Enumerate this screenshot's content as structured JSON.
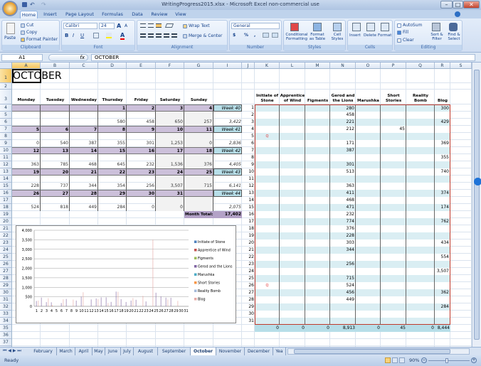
{
  "window": {
    "title": "WritingProgress2015.xlsx - Microsoft Excel non-commercial use"
  },
  "ribbon": {
    "tabs": [
      "Home",
      "Insert",
      "Page Layout",
      "Formulas",
      "Data",
      "Review",
      "View"
    ],
    "active_tab": "Home",
    "clipboard": {
      "label": "Clipboard",
      "paste": "Paste",
      "cut": "Cut",
      "copy": "Copy",
      "format_painter": "Format Painter"
    },
    "font": {
      "label": "Font",
      "name": "Calibri",
      "size": "24",
      "bold": "B",
      "italic": "I",
      "underline": "U",
      "grow": "A",
      "shrink": "A",
      "color": "A"
    },
    "alignment": {
      "label": "Alignment",
      "wrap": "Wrap Text",
      "merge": "Merge & Center"
    },
    "number": {
      "label": "Number",
      "format": "General",
      "currency": "$",
      "percent": "%",
      "comma": ","
    },
    "styles": {
      "label": "Styles",
      "conditional": "Conditional Formatting",
      "format_table": "Format as Table",
      "cell_styles": "Cell Styles"
    },
    "cells": {
      "label": "Cells",
      "insert": "Insert",
      "delete": "Delete",
      "format": "Format"
    },
    "editing": {
      "label": "Editing",
      "autosum": "AutoSum",
      "fill": "Fill",
      "clear": "Clear",
      "sort": "Sort & Filter",
      "find": "Find & Select"
    }
  },
  "formula_bar": {
    "name_box": "A1",
    "fx": "fx",
    "value": "OCTOBER"
  },
  "columns": [
    "A",
    "B",
    "C",
    "D",
    "E",
    "F",
    "G",
    "I",
    "J",
    "K",
    "L",
    "M",
    "N",
    "O",
    "P",
    "Q",
    "R",
    "S"
  ],
  "rows": [
    "1",
    "2",
    "3",
    "4",
    "5",
    "6",
    "7",
    "8",
    "9",
    "10",
    "11",
    "12",
    "13",
    "14",
    "15",
    "16",
    "17",
    "18",
    "19",
    "20",
    "21",
    "22",
    "23",
    "24",
    "25",
    "26",
    "27",
    "28",
    "29",
    "30",
    "31",
    "32",
    "33",
    "34",
    "35",
    "36",
    "37",
    "38"
  ],
  "calendar": {
    "title": "OCTOBER",
    "days": [
      "Monday",
      "Tuesday",
      "Wednesday",
      "Thursday",
      "Friday",
      "Saturday",
      "Sunday"
    ],
    "weeks": [
      {
        "dates": [
          "",
          "",
          "",
          "1",
          "2",
          "3",
          "4"
        ],
        "counts": [
          "",
          "",
          "",
          "580",
          "458",
          "650",
          "257"
        ],
        "label": "Week 40",
        "total": "3,422"
      },
      {
        "dates": [
          "5",
          "6",
          "7",
          "8",
          "9",
          "10",
          "11"
        ],
        "counts": [
          "0",
          "540",
          "387",
          "355",
          "301",
          "1,253",
          "0"
        ],
        "label": "Week 41",
        "total": "2,836"
      },
      {
        "dates": [
          "12",
          "13",
          "14",
          "15",
          "16",
          "17",
          "18"
        ],
        "counts": [
          "363",
          "785",
          "468",
          "645",
          "232",
          "1,536",
          "376"
        ],
        "label": "Week 42",
        "total": "4,405"
      },
      {
        "dates": [
          "19",
          "20",
          "21",
          "22",
          "23",
          "24",
          "25"
        ],
        "counts": [
          "228",
          "737",
          "344",
          "354",
          "256",
          "3,507",
          "715"
        ],
        "label": "Week 43",
        "total": "6,141"
      },
      {
        "dates": [
          "26",
          "27",
          "28",
          "29",
          "30",
          "31",
          ""
        ],
        "counts": [
          "524",
          "818",
          "449",
          "284",
          "0",
          "0",
          ""
        ],
        "label": "Week 44",
        "total": "2,075"
      }
    ],
    "month_total_label": "Month Total:",
    "month_total": "17,402"
  },
  "tracker": {
    "headers": [
      "Initiate of Stone",
      "Apprentice of Wind",
      "Figments",
      "Gerod and the Lions",
      "Marushka",
      "Short Stories",
      "Reality Bomb",
      "Blog"
    ],
    "marker_days": [
      "5",
      "26"
    ],
    "marker_text": "Q",
    "rows": [
      {
        "day": "1",
        "values": [
          "",
          "",
          "",
          "280",
          "",
          "",
          "",
          "300"
        ]
      },
      {
        "day": "2",
        "values": [
          "",
          "",
          "",
          "458",
          "",
          "",
          "",
          ""
        ]
      },
      {
        "day": "3",
        "values": [
          "",
          "",
          "",
          "221",
          "",
          "",
          "",
          "429"
        ]
      },
      {
        "day": "4",
        "values": [
          "",
          "",
          "",
          "212",
          "",
          "45",
          "",
          ""
        ]
      },
      {
        "day": "5",
        "values": [
          "",
          "",
          "",
          "",
          "",
          "",
          "",
          ""
        ]
      },
      {
        "day": "6",
        "values": [
          "",
          "",
          "",
          "171",
          "",
          "",
          "",
          "369"
        ]
      },
      {
        "day": "7",
        "values": [
          "",
          "",
          "",
          "387",
          "",
          "",
          "",
          ""
        ]
      },
      {
        "day": "8",
        "values": [
          "",
          "",
          "",
          "",
          "",
          "",
          "",
          "355"
        ]
      },
      {
        "day": "9",
        "values": [
          "",
          "",
          "",
          "301",
          "",
          "",
          "",
          ""
        ]
      },
      {
        "day": "10",
        "values": [
          "",
          "",
          "",
          "513",
          "",
          "",
          "",
          "740"
        ]
      },
      {
        "day": "11",
        "values": [
          "",
          "",
          "",
          "",
          "",
          "",
          "",
          ""
        ]
      },
      {
        "day": "12",
        "values": [
          "",
          "",
          "",
          "363",
          "",
          "",
          "",
          ""
        ]
      },
      {
        "day": "13",
        "values": [
          "",
          "",
          "",
          "411",
          "",
          "",
          "",
          "374"
        ]
      },
      {
        "day": "14",
        "values": [
          "",
          "",
          "",
          "468",
          "",
          "",
          "",
          ""
        ]
      },
      {
        "day": "15",
        "values": [
          "",
          "",
          "",
          "471",
          "",
          "",
          "",
          "174"
        ]
      },
      {
        "day": "16",
        "values": [
          "",
          "",
          "",
          "232",
          "",
          "",
          "",
          ""
        ]
      },
      {
        "day": "17",
        "values": [
          "",
          "",
          "",
          "774",
          "",
          "",
          "",
          "762"
        ]
      },
      {
        "day": "18",
        "values": [
          "",
          "",
          "",
          "376",
          "",
          "",
          "",
          ""
        ]
      },
      {
        "day": "19",
        "values": [
          "",
          "",
          "",
          "228",
          "",
          "",
          "",
          ""
        ]
      },
      {
        "day": "20",
        "values": [
          "",
          "",
          "",
          "303",
          "",
          "",
          "",
          "434"
        ]
      },
      {
        "day": "21",
        "values": [
          "",
          "",
          "",
          "344",
          "",
          "",
          "",
          ""
        ]
      },
      {
        "day": "22",
        "values": [
          "",
          "",
          "",
          "",
          "",
          "",
          "",
          "554"
        ]
      },
      {
        "day": "23",
        "values": [
          "",
          "",
          "",
          "256",
          "",
          "",
          "",
          ""
        ]
      },
      {
        "day": "24",
        "values": [
          "",
          "",
          "",
          "",
          "",
          "",
          "",
          "3,507"
        ]
      },
      {
        "day": "25",
        "values": [
          "",
          "",
          "",
          "715",
          "",
          "",
          "",
          ""
        ]
      },
      {
        "day": "26",
        "values": [
          "",
          "",
          "",
          "524",
          "",
          "",
          "",
          ""
        ]
      },
      {
        "day": "27",
        "values": [
          "",
          "",
          "",
          "456",
          "",
          "",
          "",
          "362"
        ]
      },
      {
        "day": "28",
        "values": [
          "",
          "",
          "",
          "449",
          "",
          "",
          "",
          ""
        ]
      },
      {
        "day": "29",
        "values": [
          "",
          "",
          "",
          "",
          "",
          "",
          "",
          "284"
        ]
      },
      {
        "day": "30",
        "values": [
          "",
          "",
          "",
          "",
          "",
          "",
          "",
          ""
        ]
      },
      {
        "day": "31",
        "values": [
          "",
          "",
          "",
          "",
          "",
          "",
          "",
          ""
        ]
      }
    ],
    "totals": [
      "0",
      "0",
      "0",
      "8,913",
      "0",
      "45",
      "0",
      "8,444"
    ],
    "colors": {
      "stripe": "#daeef3",
      "total": "#b7dee8",
      "border": "#c0392b"
    }
  },
  "chart_data": {
    "type": "bar",
    "categories": [
      "1",
      "2",
      "3",
      "4",
      "5",
      "6",
      "7",
      "8",
      "9",
      "10",
      "11",
      "12",
      "13",
      "14",
      "15",
      "16",
      "17",
      "18",
      "19",
      "20",
      "21",
      "22",
      "23",
      "24",
      "25",
      "26",
      "27",
      "28",
      "29",
      "30",
      "31"
    ],
    "ylim": [
      0,
      4000
    ],
    "yticks": [
      "0",
      "500",
      "1,000",
      "1,500",
      "2,000",
      "2,500",
      "3,000",
      "3,500",
      "4,000"
    ],
    "grid": true,
    "legend": "right",
    "series": [
      {
        "name": "Initiate of Stone",
        "color": "#4f81bd",
        "values": [
          0,
          0,
          0,
          0,
          0,
          0,
          0,
          0,
          0,
          0,
          0,
          0,
          0,
          0,
          0,
          0,
          0,
          0,
          0,
          0,
          0,
          0,
          0,
          0,
          0,
          0,
          0,
          0,
          0,
          0,
          0
        ]
      },
      {
        "name": "Apprentice of Wind",
        "color": "#c0504d",
        "values": [
          0,
          0,
          0,
          0,
          0,
          0,
          0,
          0,
          0,
          0,
          0,
          0,
          0,
          0,
          0,
          0,
          0,
          0,
          0,
          0,
          0,
          0,
          0,
          0,
          0,
          0,
          0,
          0,
          0,
          0,
          0
        ]
      },
      {
        "name": "Figments",
        "color": "#9bbb59",
        "values": [
          0,
          0,
          0,
          0,
          0,
          0,
          0,
          0,
          0,
          0,
          0,
          0,
          0,
          0,
          0,
          0,
          0,
          0,
          0,
          0,
          0,
          0,
          0,
          0,
          0,
          0,
          0,
          0,
          0,
          0,
          0
        ]
      },
      {
        "name": "Gerod and the Lions",
        "color": "#8064a2",
        "values": [
          280,
          458,
          221,
          212,
          0,
          171,
          387,
          0,
          301,
          513,
          0,
          363,
          411,
          468,
          471,
          232,
          774,
          376,
          228,
          303,
          344,
          0,
          256,
          0,
          715,
          524,
          456,
          449,
          0,
          0,
          0
        ]
      },
      {
        "name": "Marushka",
        "color": "#4bacc6",
        "values": [
          0,
          0,
          0,
          0,
          0,
          0,
          0,
          0,
          0,
          0,
          0,
          0,
          0,
          0,
          0,
          0,
          0,
          0,
          0,
          0,
          0,
          0,
          0,
          0,
          0,
          0,
          0,
          0,
          0,
          0,
          0
        ]
      },
      {
        "name": "Short Stories",
        "color": "#f79646",
        "values": [
          0,
          0,
          0,
          45,
          0,
          0,
          0,
          0,
          0,
          0,
          0,
          0,
          0,
          0,
          0,
          0,
          0,
          0,
          0,
          0,
          0,
          0,
          0,
          0,
          0,
          0,
          0,
          0,
          0,
          0,
          0
        ]
      },
      {
        "name": "Reality Bomb",
        "color": "#a5b9d8",
        "values": [
          0,
          0,
          0,
          0,
          0,
          0,
          0,
          0,
          0,
          0,
          0,
          0,
          0,
          0,
          0,
          0,
          0,
          0,
          0,
          0,
          0,
          0,
          0,
          0,
          0,
          0,
          0,
          0,
          0,
          0,
          0
        ]
      },
      {
        "name": "Blog",
        "color": "#e6a9a5",
        "values": [
          300,
          0,
          429,
          0,
          0,
          369,
          0,
          355,
          0,
          740,
          0,
          0,
          374,
          0,
          174,
          0,
          762,
          0,
          0,
          434,
          0,
          554,
          0,
          3507,
          0,
          0,
          362,
          0,
          284,
          0,
          0
        ]
      }
    ]
  },
  "sheet_tabs": [
    "February",
    "March",
    "April",
    "May",
    "June",
    "July",
    "August",
    "September",
    "October",
    "November",
    "December",
    "Yea"
  ],
  "active_sheet": "October",
  "status": {
    "ready": "Ready",
    "zoom": "90%"
  }
}
